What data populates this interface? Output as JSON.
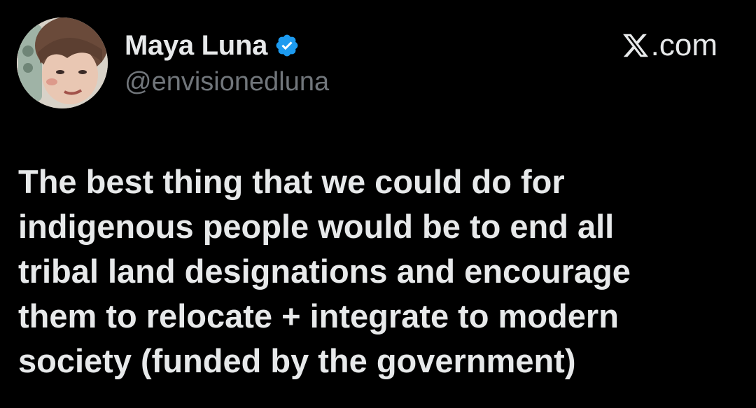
{
  "author": {
    "display_name": "Maya Luna",
    "handle": "@envisionedluna",
    "verified": true
  },
  "site": {
    "label": ".com",
    "icon": "x-logo-icon"
  },
  "tweet": {
    "lines": [
      "The best thing that we could do for",
      "indigenous people would be to end all",
      "tribal land designations and encourage",
      "them to relocate + integrate to modern",
      "society (funded by the government)"
    ]
  },
  "colors": {
    "background": "#000000",
    "text": "#e7e9ea",
    "secondary_text": "#71767b",
    "verified_badge": "#1d9bf0"
  }
}
